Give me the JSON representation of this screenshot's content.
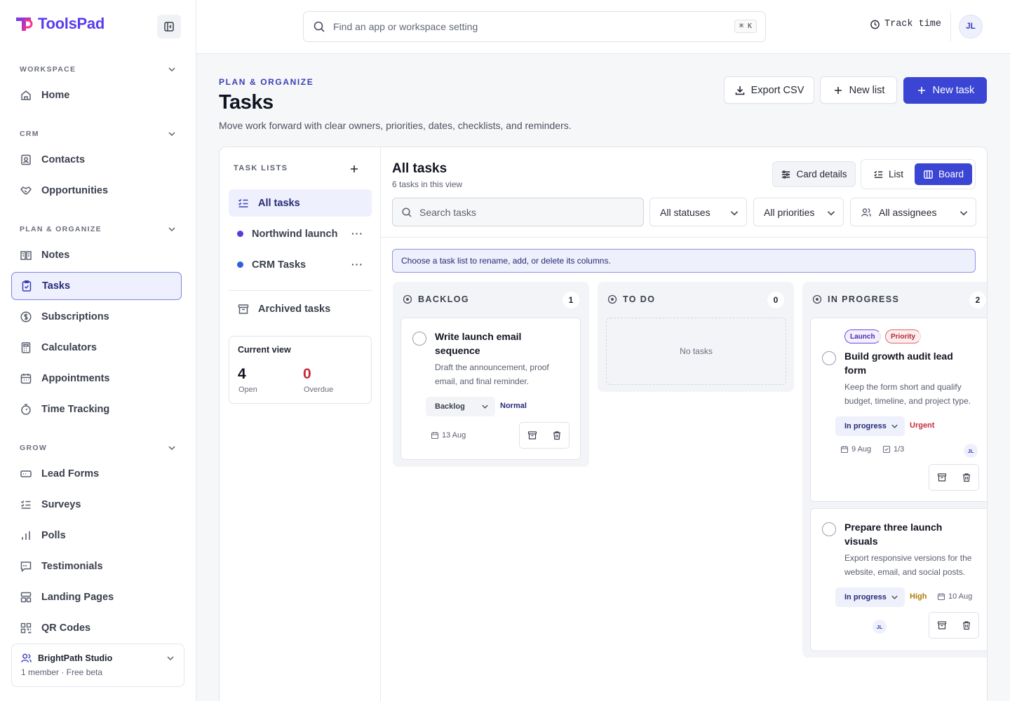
{
  "brand": {
    "name": "ToolsPad"
  },
  "sidebar": {
    "sections": [
      {
        "label": "WORKSPACE",
        "items": [
          {
            "label": "Home",
            "icon": "home-icon"
          }
        ]
      },
      {
        "label": "CRM",
        "items": [
          {
            "label": "Contacts",
            "icon": "contacts-icon"
          },
          {
            "label": "Opportunities",
            "icon": "handshake-icon"
          }
        ]
      },
      {
        "label": "PLAN & ORGANIZE",
        "items": [
          {
            "label": "Notes",
            "icon": "notebook-icon"
          },
          {
            "label": "Tasks",
            "icon": "clipboard-check-icon",
            "active": true
          },
          {
            "label": "Subscriptions",
            "icon": "dollar-circle-icon"
          },
          {
            "label": "Calculators",
            "icon": "calculator-icon"
          },
          {
            "label": "Appointments",
            "icon": "calendar-icon"
          },
          {
            "label": "Time Tracking",
            "icon": "stopwatch-icon"
          }
        ]
      },
      {
        "label": "GROW",
        "items": [
          {
            "label": "Lead Forms",
            "icon": "form-icon"
          },
          {
            "label": "Surveys",
            "icon": "checklist-icon"
          },
          {
            "label": "Polls",
            "icon": "bar-chart-icon"
          },
          {
            "label": "Testimonials",
            "icon": "quote-icon"
          },
          {
            "label": "Landing Pages",
            "icon": "layout-icon"
          },
          {
            "label": "QR Codes",
            "icon": "qr-icon"
          }
        ]
      }
    ],
    "workspace": {
      "name": "BrightPath Studio",
      "meta": "1 member · Free beta"
    }
  },
  "topbar": {
    "search_placeholder": "Find an app or workspace setting",
    "shortcut": "⌘ K",
    "track_time": "Track time",
    "user_initials": "JL"
  },
  "page": {
    "eyebrow": "PLAN & ORGANIZE",
    "title": "Tasks",
    "description": "Move work forward with clear owners, priorities, dates, checklists, and reminders.",
    "export_label": "Export CSV",
    "new_list_label": "New list",
    "new_task_label": "New task"
  },
  "lists": {
    "heading": "TASK LISTS",
    "items": [
      {
        "label": "All tasks",
        "active": true
      },
      {
        "label": "Northwind launch",
        "color": "#5b3bd8"
      },
      {
        "label": "CRM Tasks",
        "color": "#2f5fe0"
      }
    ],
    "more_glyph": "···",
    "archived_label": "Archived tasks",
    "current_view": {
      "title": "Current view",
      "open_count": "4",
      "open_label": "Open",
      "overdue_count": "0",
      "overdue_label": "Overdue"
    }
  },
  "board": {
    "title": "All tasks",
    "subtitle": "6 tasks in this view",
    "card_details_label": "Card details",
    "view_list_label": "List",
    "view_board_label": "Board",
    "search_placeholder": "Search tasks",
    "filters": {
      "status": "All statuses",
      "priority": "All priorities",
      "assignee": "All assignees"
    },
    "banner": "Choose a task list to rename, add, or delete its columns.",
    "columns": [
      {
        "name": "BACKLOG",
        "count": "1",
        "tasks": [
          {
            "title": "Write launch email sequence",
            "description": "Draft the announcement, proof email, and final reminder.",
            "status": "Backlog",
            "priority": "Normal",
            "priority_color": "#262a78",
            "due": "13 Aug"
          }
        ]
      },
      {
        "name": "TO DO",
        "count": "0",
        "empty_label": "No tasks"
      },
      {
        "name": "IN PROGRESS",
        "count": "2",
        "tasks": [
          {
            "tags": [
              "Launch",
              "Priority"
            ],
            "title": "Build growth audit lead form",
            "description": "Keep the form short and qualify budget, timeline, and project type.",
            "status": "In progress",
            "priority": "Urgent",
            "priority_color": "#c42b3a",
            "due": "9 Aug",
            "checklist": "1/3",
            "assignee": "JL"
          },
          {
            "title": "Prepare three launch visuals",
            "description": "Export responsive versions for the website, email, and social posts.",
            "status": "In progress",
            "priority": "High",
            "priority_color": "#b07a05",
            "due": "10 Aug",
            "assignee": "JL"
          }
        ]
      }
    ]
  }
}
